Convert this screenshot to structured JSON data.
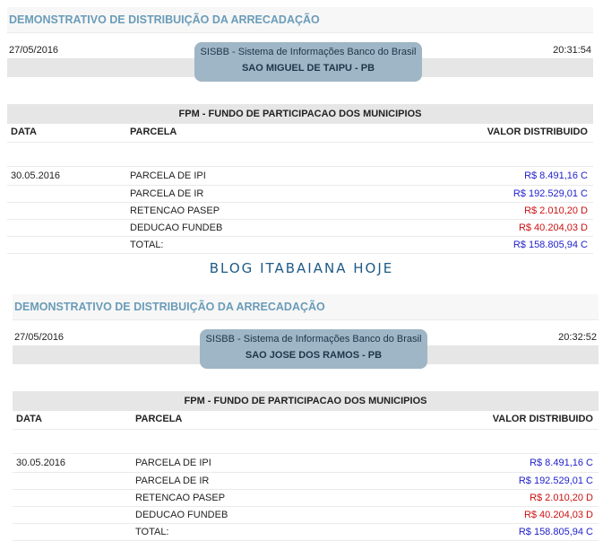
{
  "reports": [
    {
      "title": "DEMONSTRATIVO DE DISTRIBUIÇÃO DA ARRECADAÇÃO",
      "date": "27/05/2016",
      "time": "20:31:54",
      "system": "SISBB - Sistema de Informações Banco do Brasil",
      "municipality": "SAO MIGUEL DE TAIPU - PB",
      "fund": "FPM - FUNDO DE PARTICIPACAO DOS MUNICIPIOS",
      "columns": {
        "data": "DATA",
        "parcela": "PARCELA",
        "valor": "VALOR DISTRIBUIDO"
      },
      "rows": [
        {
          "data": "30.05.2016",
          "parcela": "PARCELA DE IPI",
          "valor": "R$ 8.491,16 C"
        },
        {
          "data": "",
          "parcela": "PARCELA DE IR",
          "valor": "R$ 192.529,01 C"
        },
        {
          "data": "",
          "parcela": "RETENCAO PASEP",
          "valor": "R$ 2.010,20 D"
        },
        {
          "data": "",
          "parcela": "DEDUCAO FUNDEB",
          "valor": "R$ 40.204,03 D"
        },
        {
          "data": "",
          "parcela": "TOTAL:",
          "valor": "R$ 158.805,94 C"
        }
      ]
    },
    {
      "title": "DEMONSTRATIVO DE DISTRIBUIÇÃO DA ARRECADAÇÃO",
      "date": "27/05/2016",
      "time": "20:32:52",
      "system": "SISBB - Sistema de Informações Banco do Brasil",
      "municipality": "SAO JOSE DOS RAMOS - PB",
      "fund": "FPM - FUNDO DE PARTICIPACAO DOS MUNICIPIOS",
      "columns": {
        "data": "DATA",
        "parcela": "PARCELA",
        "valor": "VALOR DISTRIBUIDO"
      },
      "rows": [
        {
          "data": "30.05.2016",
          "parcela": "PARCELA DE IPI",
          "valor": "R$ 8.491,16 C"
        },
        {
          "data": "",
          "parcela": "PARCELA DE IR",
          "valor": "R$ 192.529,01 C"
        },
        {
          "data": "",
          "parcela": "RETENCAO PASEP",
          "valor": "R$ 2.010,20 D"
        },
        {
          "data": "",
          "parcela": "DEDUCAO FUNDEB",
          "valor": "R$ 40.204,03 D"
        },
        {
          "data": "",
          "parcela": "TOTAL:",
          "valor": "R$ 158.805,94 C"
        }
      ]
    }
  ],
  "blog_title": "BLOG ITABAIANA HOJE",
  "colors": {
    "title": "#6a9cb8",
    "credit": "#2222cc",
    "debit": "#cc1111",
    "bubble": "#9fb6c6",
    "blog": "#1e5a86"
  }
}
